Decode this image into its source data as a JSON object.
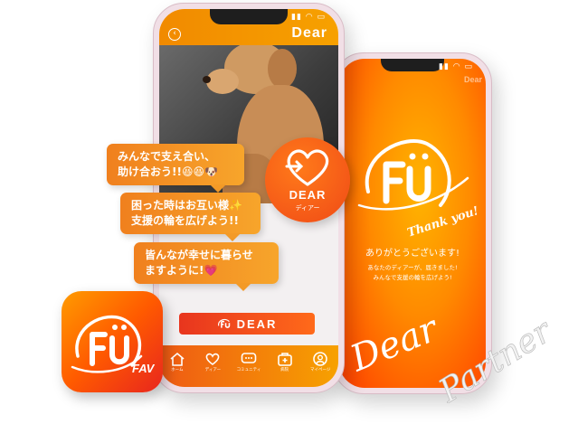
{
  "front_phone": {
    "header_title": "Dear",
    "status": "▮▮ ◠ ▭",
    "cta_button": "DEAR",
    "tabs": [
      {
        "icon": "home-icon",
        "label": "ホーム"
      },
      {
        "icon": "heart-icon",
        "label": "ディアー"
      },
      {
        "icon": "chat-bubble-icon",
        "label": "コミュニティ"
      },
      {
        "icon": "medical-kit-icon",
        "label": "病院"
      },
      {
        "icon": "profile-icon",
        "label": "マイページ"
      }
    ]
  },
  "back_phone": {
    "status": "▮▮ ◠ ▭",
    "top_text": "Dear",
    "logo_script": "Thank you!",
    "message_main": "ありがとうございます!",
    "message_sub_1": "あなたのディアーが、届きました!",
    "message_sub_2": "みんなで支援の輪を広げよう!"
  },
  "bubbles": [
    {
      "line1": "みんなで支え合い、",
      "line2": "助け合おう!!😆😆🐶"
    },
    {
      "line1": "困った時はお互い様✨",
      "line2": "支援の輪を広げよう!!"
    },
    {
      "line1": "皆んなが幸せに暮らせ",
      "line2": "ますように!💗"
    }
  ],
  "dear_badge": {
    "name": "DEAR",
    "kana": "ディアー"
  },
  "app_icon": {
    "label": "FAV"
  },
  "script_text": {
    "word1": "Dear",
    "word2": "Partner"
  },
  "colors": {
    "orange": "#f39a27",
    "red_orange": "#f04a16",
    "yellow": "#ffb400"
  }
}
